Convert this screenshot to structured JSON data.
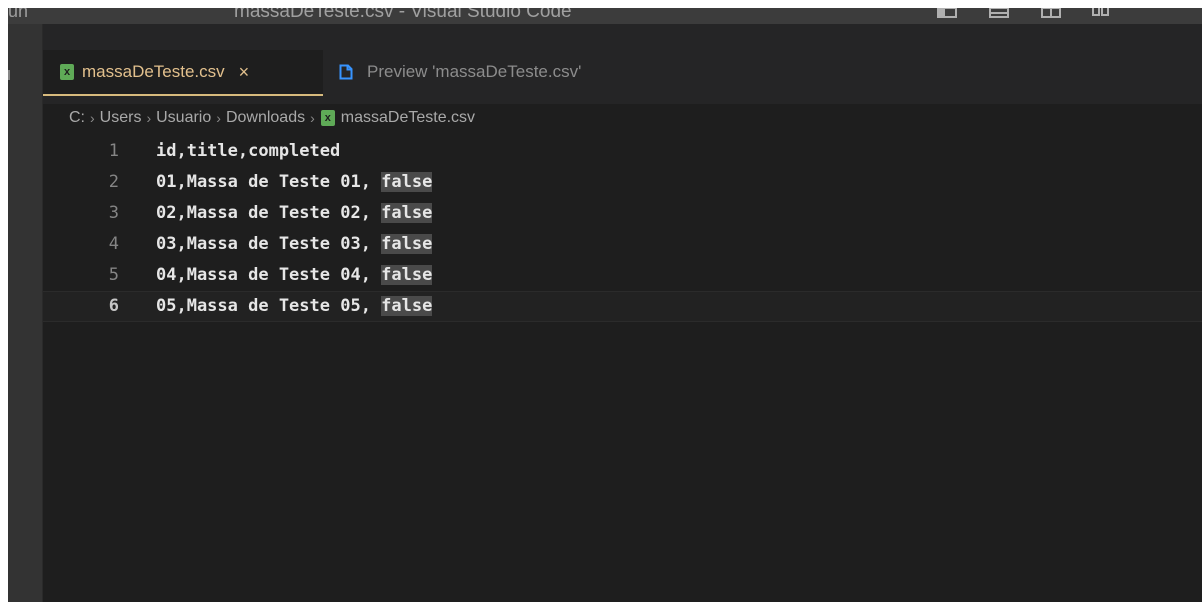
{
  "window": {
    "title": "massaDeTeste.csv - Visual Studio Code",
    "menu_stub": "un"
  },
  "layout_icons": [
    "toggle-sidebar-icon",
    "toggle-panel-icon",
    "split-editor-icon",
    "customize-layout-icon"
  ],
  "tabs": [
    {
      "label": "massaDeTeste.csv",
      "icon": "csv-file-icon",
      "close": "×",
      "active": true
    },
    {
      "label": "Preview 'massaDeTeste.csv'",
      "icon": "preview-icon",
      "active": false
    }
  ],
  "breadcrumb": {
    "items": [
      "C:",
      "Users",
      "Usuario",
      "Downloads",
      "massaDeTeste.csv"
    ],
    "separator": "›"
  },
  "editor": {
    "current_line": 6,
    "lines": [
      {
        "num": "1",
        "text": "id,title,completed"
      },
      {
        "num": "2",
        "text": "01,Massa de Teste 01, ",
        "highlight": "false"
      },
      {
        "num": "3",
        "text": "02,Massa de Teste 02, ",
        "highlight": "false"
      },
      {
        "num": "4",
        "text": "03,Massa de Teste 03, ",
        "highlight": "false"
      },
      {
        "num": "5",
        "text": "04,Massa de Teste 04, ",
        "highlight": "false"
      },
      {
        "num": "6",
        "text": "05,Massa de Teste 05, ",
        "highlight": "false"
      }
    ]
  },
  "colors": {
    "editor_bg": "#1e1e1e",
    "tab_active_fg": "#e2c08d",
    "csv_icon": "#5faa57",
    "preview_icon": "#3794ff"
  }
}
